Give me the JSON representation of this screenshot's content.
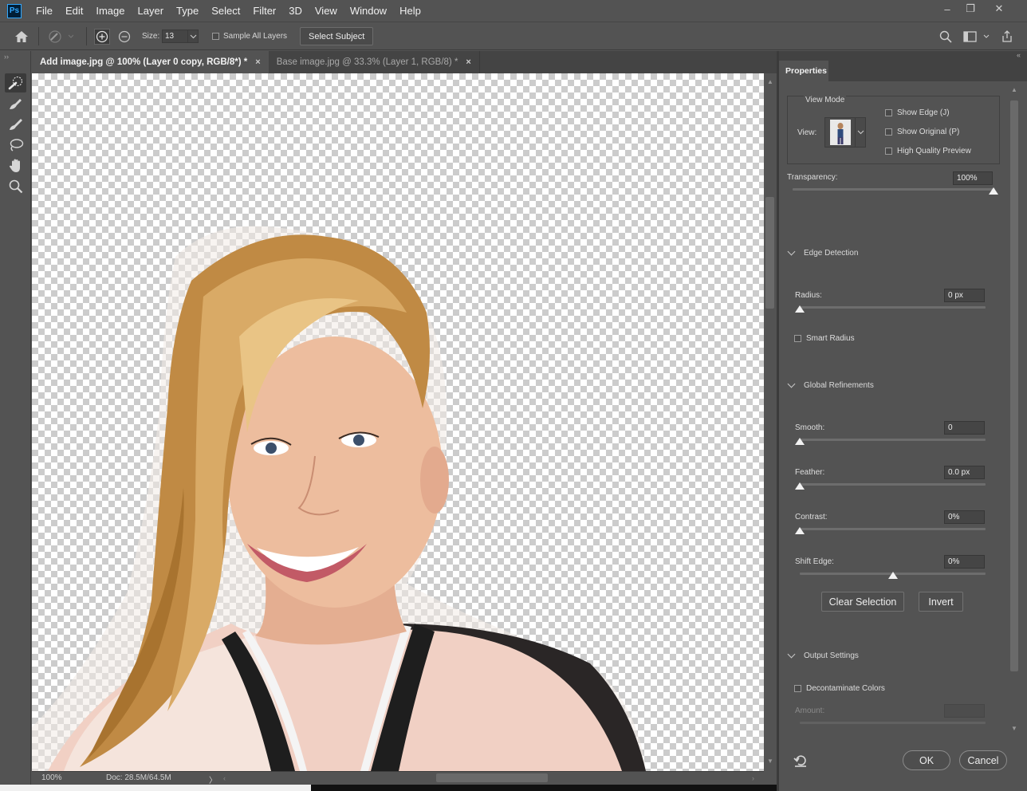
{
  "app": {
    "logo": "Ps"
  },
  "menu": [
    "File",
    "Edit",
    "Image",
    "Layer",
    "Type",
    "Select",
    "Filter",
    "3D",
    "View",
    "Window",
    "Help"
  ],
  "window_controls": {
    "minimize": "–",
    "restore": "❐",
    "close": "✕"
  },
  "options_bar": {
    "size_label": "Size:",
    "size_value": "13",
    "sample_all_layers_label": "Sample All Layers",
    "sample_all_layers_checked": false,
    "select_subject_label": "Select Subject"
  },
  "tabs": [
    {
      "label": "Add image.jpg @ 100% (Layer 0 copy, RGB/8*) *",
      "active": true,
      "close": "×"
    },
    {
      "label": "Base image.jpg @ 33.3% (Layer 1, RGB/8) *",
      "active": false,
      "close": "×"
    }
  ],
  "status": {
    "zoom": "100%",
    "doc": "Doc: 28.5M/64.5M",
    "arrow": "〉"
  },
  "properties": {
    "tab_label": "Properties",
    "view_mode": {
      "title": "View Mode",
      "view_label": "View:",
      "show_edge": "Show Edge (J)",
      "show_original": "Show Original (P)",
      "high_quality_preview": "High Quality Preview"
    },
    "transparency": {
      "label": "Transparency:",
      "value": "100%",
      "level": 1.0
    },
    "edge_detection": {
      "title": "Edge Detection",
      "radius_label": "Radius:",
      "radius_value": "0 px",
      "radius_level": 0,
      "smart_radius": "Smart Radius"
    },
    "global_refinements": {
      "title": "Global Refinements",
      "smooth_label": "Smooth:",
      "smooth_value": "0",
      "smooth_level": 0,
      "feather_label": "Feather:",
      "feather_value": "0.0 px",
      "feather_level": 0,
      "contrast_label": "Contrast:",
      "contrast_value": "0%",
      "contrast_level": 0,
      "shift_edge_label": "Shift Edge:",
      "shift_edge_value": "0%",
      "shift_edge_level": 0.5,
      "clear_selection": "Clear Selection",
      "invert": "Invert"
    },
    "output_settings": {
      "title": "Output Settings",
      "decontaminate": "Decontaminate Colors",
      "amount_label": "Amount:",
      "amount_value": ""
    },
    "ok": "OK",
    "cancel": "Cancel"
  },
  "colors": {
    "ui_bg": "#535353",
    "hair": "#c8954d",
    "skin": "#e8b59a",
    "jacket": "#f1d0c4",
    "accent_blue": "#31a8ff"
  }
}
